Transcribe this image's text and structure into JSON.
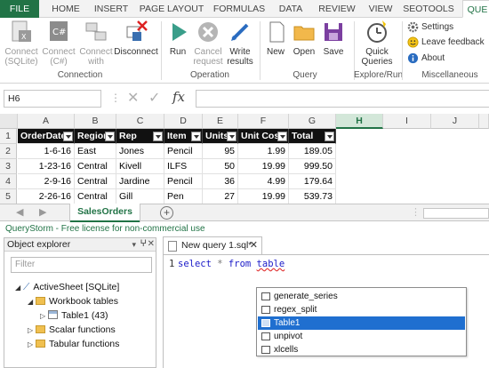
{
  "ribbon_tabs": [
    {
      "label": "FILE",
      "active": false
    },
    {
      "label": "HOME",
      "active": false
    },
    {
      "label": "INSERT",
      "active": false
    },
    {
      "label": "PAGE LAYOUT",
      "active": false
    },
    {
      "label": "FORMULAS",
      "active": false
    },
    {
      "label": "DATA",
      "active": false
    },
    {
      "label": "REVIEW",
      "active": false
    },
    {
      "label": "VIEW",
      "active": false
    },
    {
      "label": "SEOTOOLS",
      "active": false
    },
    {
      "label": "QUE",
      "active": true
    }
  ],
  "ribbon": {
    "connection": {
      "label": "Connection",
      "buttons": [
        {
          "label1": "Connect",
          "label2": "(SQLite)",
          "icon": "sqlite-connect-icon",
          "enabled": false
        },
        {
          "label1": "Connect",
          "label2": "(C#)",
          "icon": "csharp-connect-icon",
          "enabled": false
        },
        {
          "label1": "Connect",
          "label2": "with",
          "icon": "connect-with-icon",
          "enabled": false
        },
        {
          "label1": "Disconnect",
          "label2": "",
          "icon": "disconnect-icon",
          "enabled": true
        }
      ]
    },
    "operation": {
      "label": "Operation",
      "buttons": [
        {
          "label1": "Run",
          "label2": "",
          "icon": "run-icon",
          "enabled": true
        },
        {
          "label1": "Cancel",
          "label2": "request",
          "icon": "cancel-icon",
          "enabled": false
        },
        {
          "label1": "Write",
          "label2": "results",
          "icon": "write-results-icon",
          "enabled": true
        }
      ]
    },
    "query": {
      "label": "Query",
      "buttons": [
        {
          "label1": "New",
          "label2": "",
          "icon": "new-query-icon",
          "enabled": true
        },
        {
          "label1": "Open",
          "label2": "",
          "icon": "open-folder-icon",
          "enabled": true
        },
        {
          "label1": "Save",
          "label2": "",
          "icon": "save-icon",
          "enabled": true
        }
      ]
    },
    "explore_run": {
      "label": "Explore/Run",
      "buttons": [
        {
          "label1": "Quick",
          "label2": "Queries",
          "icon": "quick-queries-icon",
          "enabled": true
        }
      ]
    },
    "misc": {
      "label": "Miscellaneous",
      "items": [
        {
          "label": "Settings",
          "icon": "gear-icon"
        },
        {
          "label": "Leave feedback",
          "icon": "smiley-icon"
        },
        {
          "label": "About",
          "icon": "info-icon"
        }
      ]
    }
  },
  "formula_bar": {
    "name_box": "H6",
    "cancel_symbol": "✕",
    "enter_symbol": "✓",
    "fx_symbol": "fx",
    "value": ""
  },
  "grid": {
    "columns": [
      "A",
      "B",
      "C",
      "D",
      "E",
      "F",
      "G",
      "H",
      "I",
      "J"
    ],
    "selected_column": "H",
    "rows": [
      "1",
      "2",
      "3",
      "4",
      "5"
    ],
    "table_headers": [
      "OrderDate",
      "Region",
      "Rep",
      "Item",
      "Units",
      "Unit Cost",
      "Total"
    ],
    "table_rows": [
      [
        "1-6-16",
        "East",
        "Jones",
        "Pencil",
        "95",
        "1.99",
        "189.05"
      ],
      [
        "1-23-16",
        "Central",
        "Kivell",
        "ILFS",
        "50",
        "19.99",
        "999.50"
      ],
      [
        "2-9-16",
        "Central",
        "Jardine",
        "Pencil",
        "36",
        "4.99",
        "179.64"
      ],
      [
        "2-26-16",
        "Central",
        "Gill",
        "Pen",
        "27",
        "19.99",
        "539.73"
      ]
    ]
  },
  "sheet_tabs": {
    "active": "SalesOrders",
    "add_symbol": "+"
  },
  "license_text": "QueryStorm - Free license for non-commercial use",
  "object_explorer": {
    "title": "Object explorer",
    "filter_placeholder": "Filter",
    "tree": {
      "root": "ActiveSheet  [SQLite]",
      "workbook_tables": "Workbook tables",
      "table1": "Table1 (43)",
      "scalar_functions": "Scalar functions",
      "tabular_functions": "Tabular functions"
    }
  },
  "editor": {
    "tab_title": "New query 1.sql*",
    "line_number": "1",
    "code": {
      "select": "select",
      "star": "*",
      "from": "from",
      "ident": "table"
    },
    "autocomplete": [
      {
        "label": "generate_series",
        "selected": false
      },
      {
        "label": "regex_split",
        "selected": false
      },
      {
        "label": "Table1",
        "selected": true
      },
      {
        "label": "unpivot",
        "selected": false
      },
      {
        "label": "xlcells",
        "selected": false
      }
    ]
  },
  "colors": {
    "excel_green": "#217346",
    "selection_blue": "#1f6fd0",
    "keyword_blue": "#1a1ac8"
  }
}
